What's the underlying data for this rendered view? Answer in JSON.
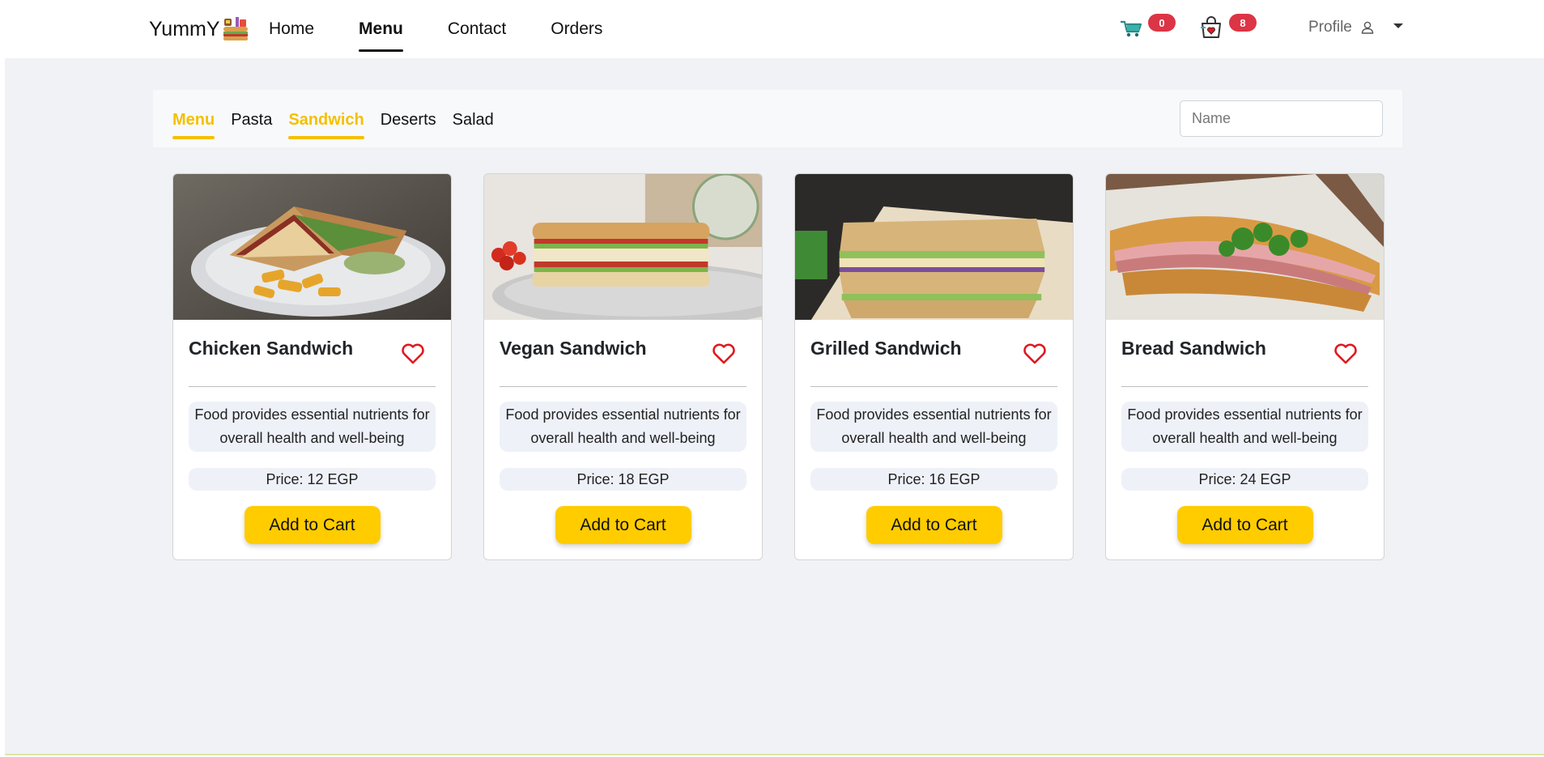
{
  "brand": {
    "name": "YummY",
    "logo_icon": "food-logo-icon"
  },
  "nav": {
    "links": [
      {
        "label": "Home",
        "active": false
      },
      {
        "label": "Menu",
        "active": true
      },
      {
        "label": "Contact",
        "active": false
      },
      {
        "label": "Orders",
        "active": false
      }
    ],
    "cart_count": "0",
    "wishlist_count": "8",
    "profile_label": "Profile"
  },
  "categories": {
    "tabs": [
      {
        "label": "Menu",
        "active": true
      },
      {
        "label": "Pasta",
        "active": false
      },
      {
        "label": "Sandwich",
        "active": true
      },
      {
        "label": "Deserts",
        "active": false
      },
      {
        "label": "Salad",
        "active": false
      }
    ],
    "search_placeholder": "Name"
  },
  "products": [
    {
      "name": "Chicken Sandwich",
      "description": "Food provides essential nutrients for overall health and well-being",
      "price": "Price: 12 EGP",
      "button": "Add to Cart"
    },
    {
      "name": "Vegan Sandwich",
      "description": "Food provides essential nutrients for overall health and well-being",
      "price": "Price: 18 EGP",
      "button": "Add to Cart"
    },
    {
      "name": "Grilled Sandwich",
      "description": "Food provides essential nutrients for overall health and well-being",
      "price": "Price: 16 EGP",
      "button": "Add to Cart"
    },
    {
      "name": "Bread Sandwich",
      "description": "Food provides essential nutrients for overall health and well-being",
      "price": "Price: 24 EGP",
      "button": "Add to Cart"
    }
  ],
  "colors": {
    "accent": "#ffcc00",
    "active_tab": "#f5c000",
    "badge": "#dc3545",
    "heart": "#e0191f"
  }
}
